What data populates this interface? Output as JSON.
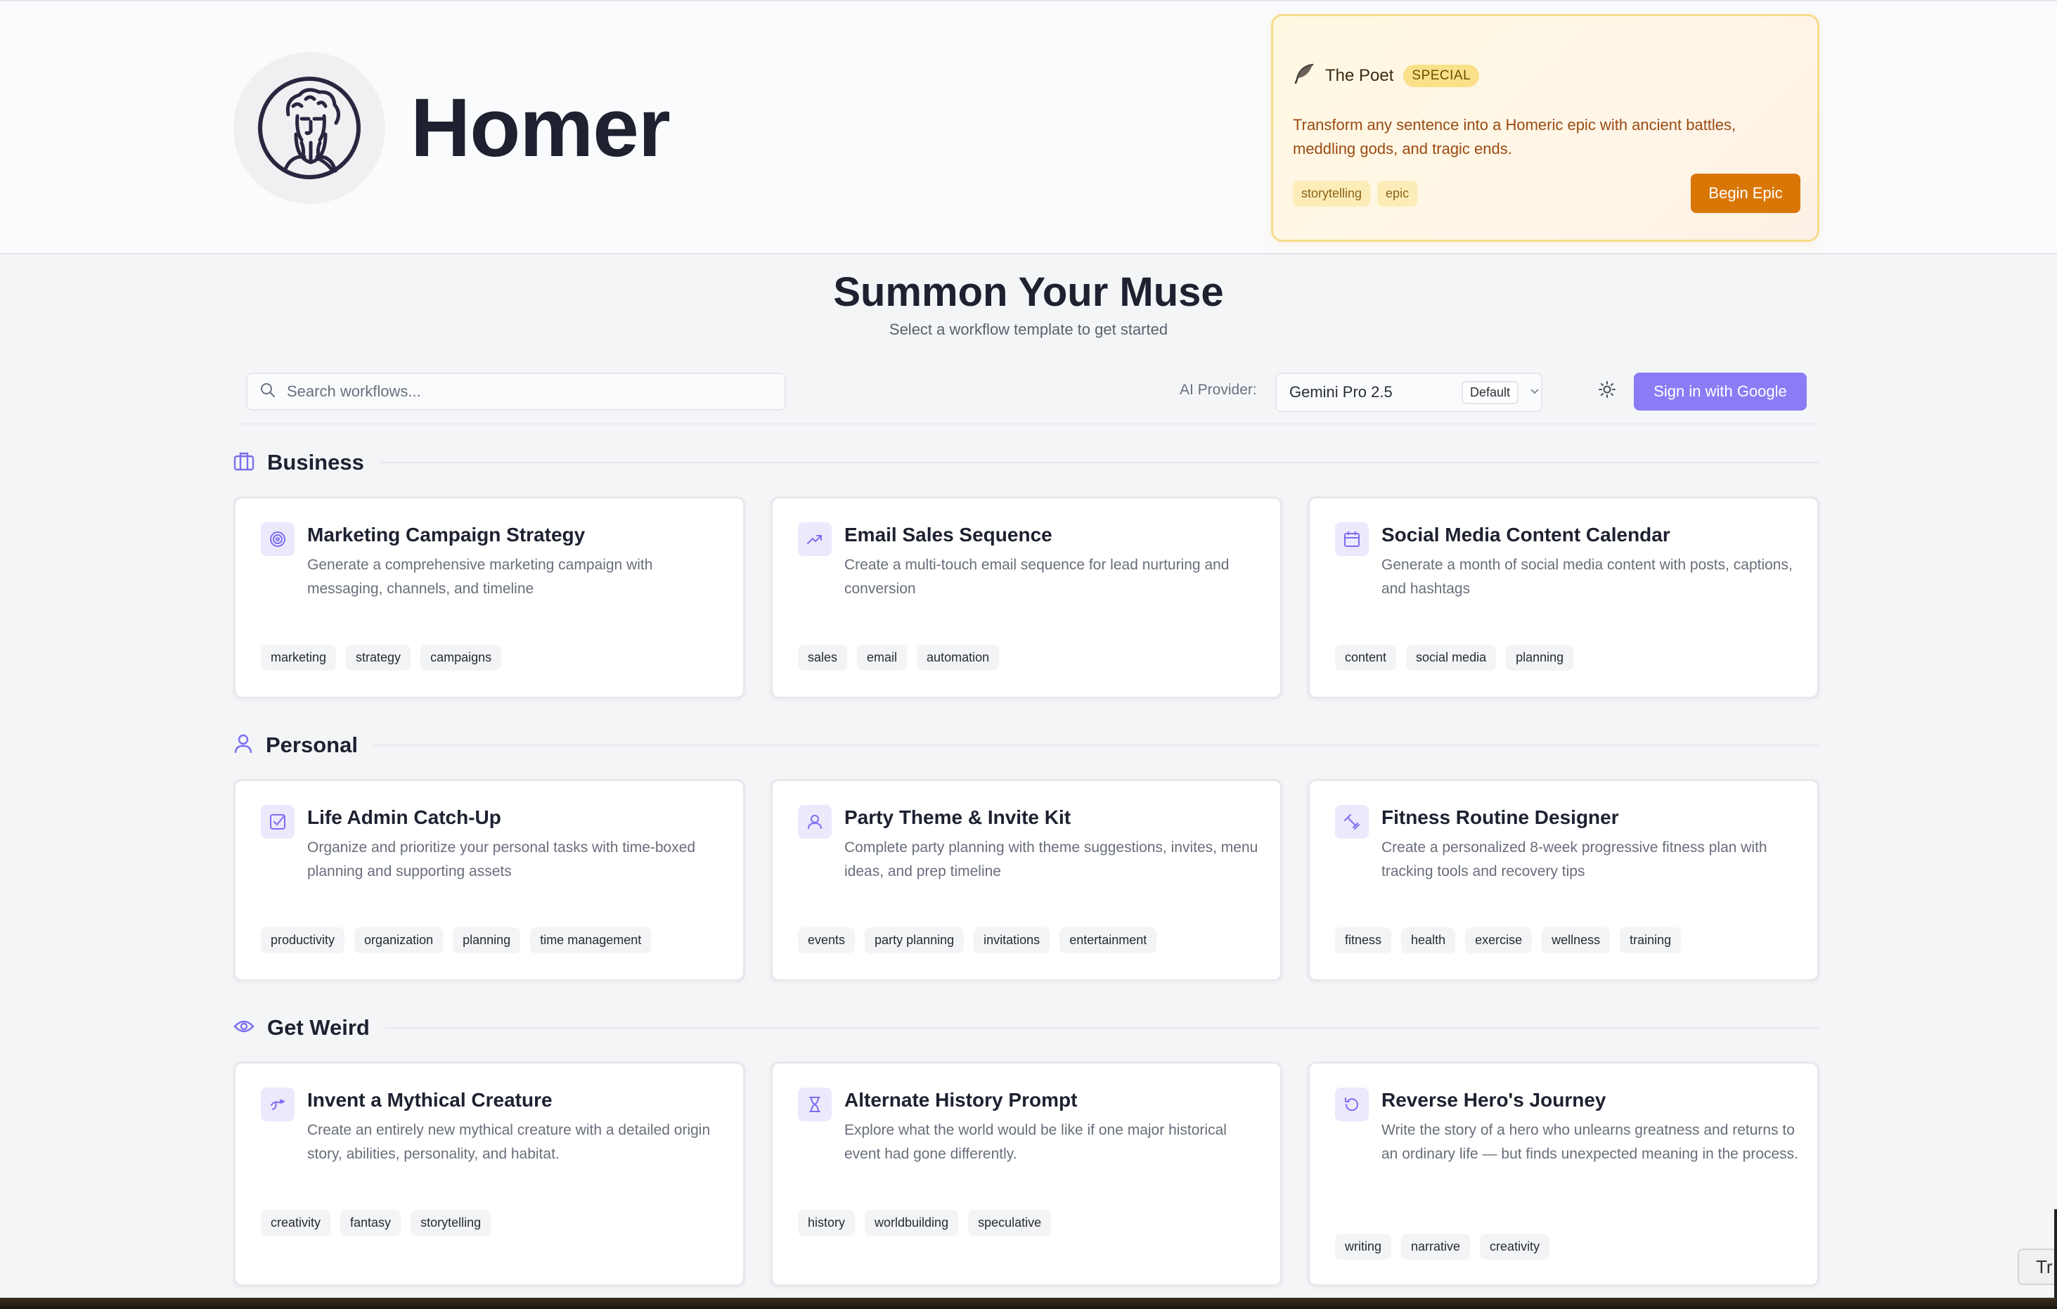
{
  "app": {
    "title": "Homer"
  },
  "promo": {
    "icon": "feather-icon",
    "title": "The Poet",
    "badge": "SPECIAL",
    "description": "Transform any sentence into a Homeric epic with ancient battles, meddling gods, and tragic ends.",
    "tags": [
      "storytelling",
      "epic"
    ],
    "button_label": "Begin Epic",
    "accent_color": "#d97706"
  },
  "hero": {
    "title": "Summon Your Muse",
    "subtitle": "Select a workflow template to get started"
  },
  "toolbar": {
    "search_placeholder": "Search workflows...",
    "provider_label": "AI Provider:",
    "provider_value": "Gemini Pro 2.5",
    "provider_default": "Default",
    "signin_label": "Sign in with Google",
    "signin_color": "#8b7cf6"
  },
  "sections": [
    {
      "title": "Business",
      "icon": "briefcase-icon",
      "cards": [
        {
          "title": "Marketing Campaign Strategy",
          "icon": "target-icon",
          "description": "Generate a comprehensive marketing campaign with messaging, channels, and timeline",
          "tags": [
            "marketing",
            "strategy",
            "campaigns"
          ]
        },
        {
          "title": "Email Sales Sequence",
          "icon": "trending-up-icon",
          "description": "Create a multi-touch email sequence for lead nurturing and conversion",
          "tags": [
            "sales",
            "email",
            "automation"
          ]
        },
        {
          "title": "Social Media Content Calendar",
          "icon": "calendar-icon",
          "description": "Generate a month of social media content with posts, captions, and hashtags",
          "tags": [
            "content",
            "social media",
            "planning"
          ]
        }
      ]
    },
    {
      "title": "Personal",
      "icon": "user-icon",
      "cards": [
        {
          "title": "Life Admin Catch-Up",
          "icon": "checkbox-icon",
          "description": "Organize and prioritize your personal tasks with time-boxed planning and supporting assets",
          "tags": [
            "productivity",
            "organization",
            "planning",
            "time management"
          ]
        },
        {
          "title": "Party Theme & Invite Kit",
          "icon": "user-icon",
          "description": "Complete party planning with theme suggestions, invites, menu ideas, and prep timeline",
          "tags": [
            "events",
            "party planning",
            "invitations",
            "entertainment"
          ]
        },
        {
          "title": "Fitness Routine Designer",
          "icon": "dumbbell-icon",
          "description": "Create a personalized 8-week progressive fitness plan with tracking tools and recovery tips",
          "tags": [
            "fitness",
            "health",
            "exercise",
            "wellness",
            "training"
          ]
        }
      ]
    },
    {
      "title": "Get Weird",
      "icon": "eye-icon",
      "cards": [
        {
          "title": "Invent a Mythical Creature",
          "icon": "creature-icon",
          "description": "Create an entirely new mythical creature with a detailed origin story, abilities, personality, and habitat.",
          "tags": [
            "creativity",
            "fantasy",
            "storytelling"
          ]
        },
        {
          "title": "Alternate History Prompt",
          "icon": "hourglass-icon",
          "description": "Explore what the world would be like if one major historical event had gone differently.",
          "tags": [
            "history",
            "worldbuilding",
            "speculative"
          ]
        },
        {
          "title": "Reverse Hero's Journey",
          "icon": "rotate-ccw-icon",
          "description": "Write the story of a hero who unlearns greatness and returns to an ordinary life — but finds unexpected meaning in the process.",
          "tags": [
            "writing",
            "narrative",
            "creativity"
          ]
        }
      ]
    }
  ],
  "overlay": {
    "corner_chip": "Tr"
  }
}
